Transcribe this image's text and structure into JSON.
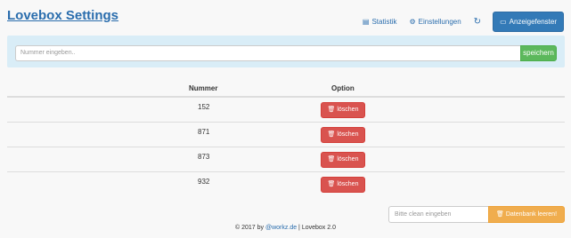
{
  "header": {
    "title": "Lovebox Settings",
    "nav": {
      "statistik": "Statistik",
      "einstellungen": "Einstellungen",
      "anzeigefenster": "Anzeigefenster"
    }
  },
  "search": {
    "placeholder": "Nummer eingeben..",
    "save_label": "speichern"
  },
  "table": {
    "columns": [
      "Nummer",
      "Option"
    ],
    "rows": [
      {
        "nummer": "152",
        "action": "löschen"
      },
      {
        "nummer": "871",
        "action": "löschen"
      },
      {
        "nummer": "873",
        "action": "löschen"
      },
      {
        "nummer": "932",
        "action": "löschen"
      }
    ]
  },
  "clean": {
    "placeholder": "Bitte clean eingeben",
    "button_label": "Datenbank leeren!"
  },
  "footer": {
    "prefix": "© 2017 by ",
    "link": "@workz.de",
    "suffix": " | Lovebox 2.0"
  },
  "colors": {
    "primary": "#337ab7",
    "success": "#5cb85c",
    "danger": "#d9534f",
    "warning": "#f0ad4e",
    "panel": "#d9edf7"
  },
  "icons": {
    "statistik": "bar-chart-icon",
    "einstellungen": "gears-icon",
    "refresh": "refresh-icon",
    "anzeigefenster": "monitor-icon",
    "delete": "trash-icon",
    "clean": "trash-icon"
  }
}
